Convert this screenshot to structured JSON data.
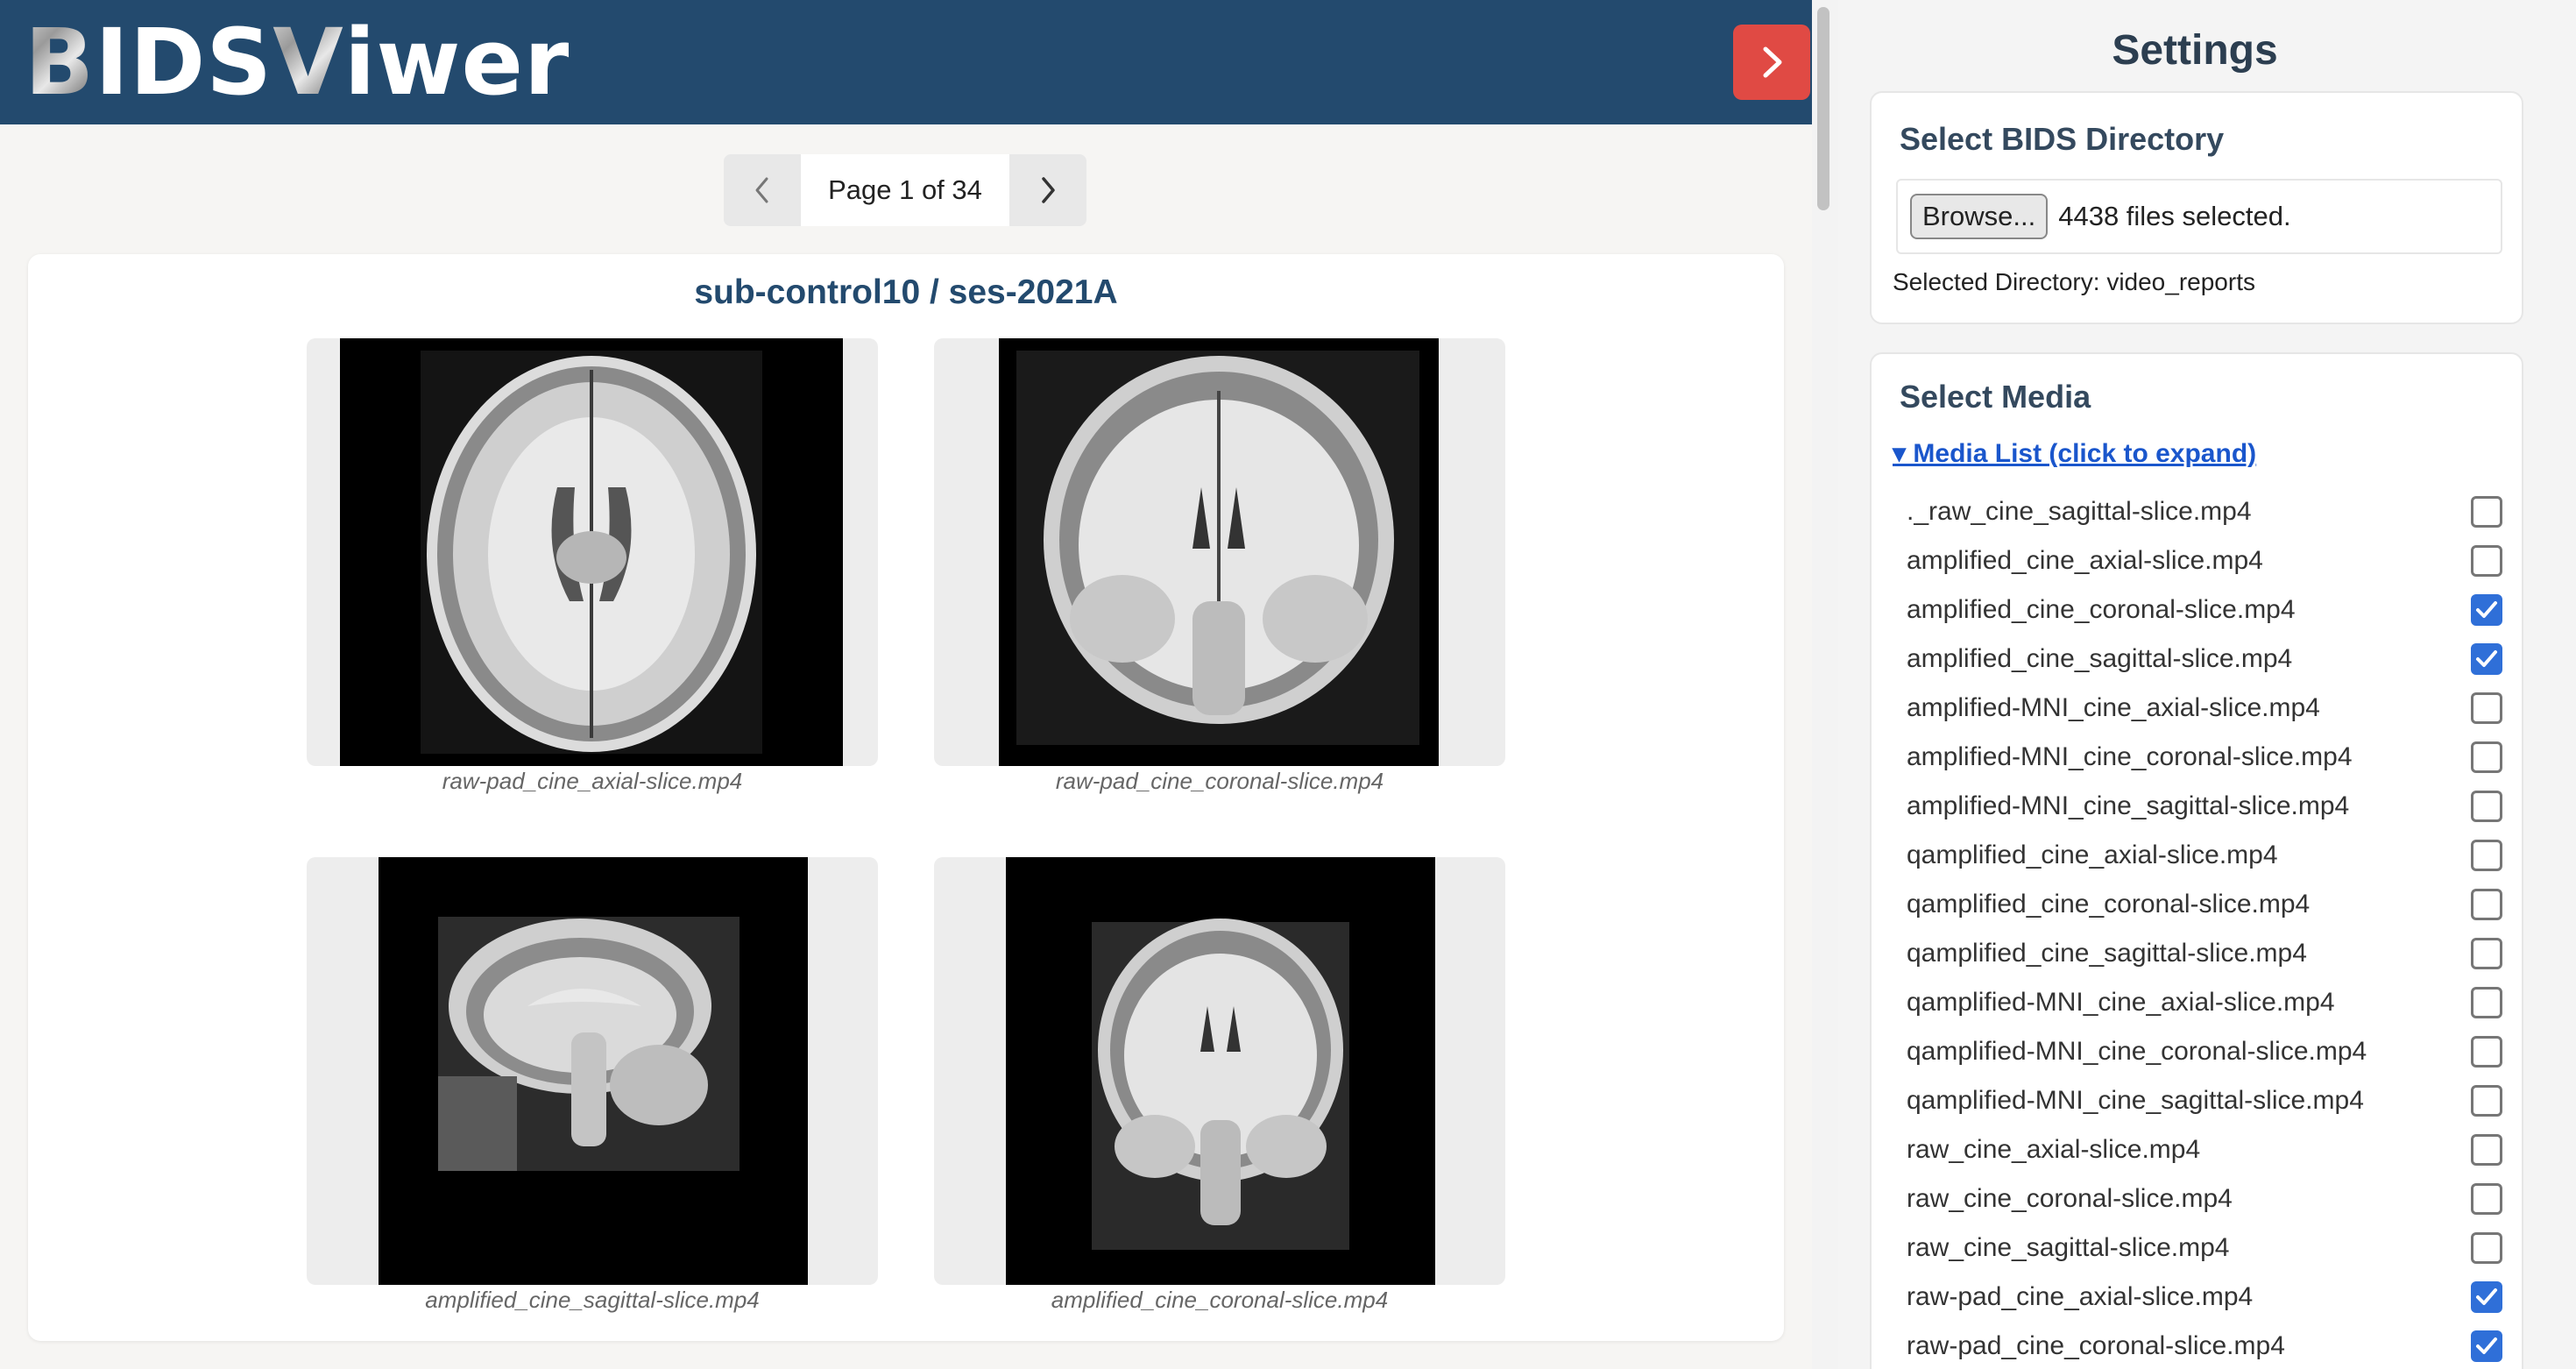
{
  "header": {
    "logo_b": "B",
    "logo_ids": "IDS",
    "logo_v": "V",
    "logo_iwer": "iwer",
    "toggle_icon": "chevron-right-icon"
  },
  "pager": {
    "text": "Page 1 of 34",
    "prev_icon": "chevron-left-icon",
    "next_icon": "chevron-right-icon"
  },
  "panel": {
    "title": "sub-control10 / ses-2021A",
    "videos": [
      {
        "caption": "raw-pad_cine_axial-slice.mp4"
      },
      {
        "caption": "raw-pad_cine_coronal-slice.mp4"
      },
      {
        "caption": "amplified_cine_sagittal-slice.mp4"
      },
      {
        "caption": "amplified_cine_coronal-slice.mp4"
      }
    ]
  },
  "sidebar": {
    "title": "Settings",
    "directory": {
      "heading": "Select BIDS Directory",
      "browse_label": "Browse...",
      "files_status": "4438 files selected.",
      "selected_directory": "Selected Directory: video_reports"
    },
    "media": {
      "heading": "Select Media",
      "summary": "▾ Media List (click to expand)",
      "items": [
        {
          "label": "._raw_cine_sagittal-slice.mp4",
          "checked": false
        },
        {
          "label": "amplified_cine_axial-slice.mp4",
          "checked": false
        },
        {
          "label": "amplified_cine_coronal-slice.mp4",
          "checked": true
        },
        {
          "label": "amplified_cine_sagittal-slice.mp4",
          "checked": true
        },
        {
          "label": "amplified-MNI_cine_axial-slice.mp4",
          "checked": false
        },
        {
          "label": "amplified-MNI_cine_coronal-slice.mp4",
          "checked": false
        },
        {
          "label": "amplified-MNI_cine_sagittal-slice.mp4",
          "checked": false
        },
        {
          "label": "qamplified_cine_axial-slice.mp4",
          "checked": false
        },
        {
          "label": "qamplified_cine_coronal-slice.mp4",
          "checked": false
        },
        {
          "label": "qamplified_cine_sagittal-slice.mp4",
          "checked": false
        },
        {
          "label": "qamplified-MNI_cine_axial-slice.mp4",
          "checked": false
        },
        {
          "label": "qamplified-MNI_cine_coronal-slice.mp4",
          "checked": false
        },
        {
          "label": "qamplified-MNI_cine_sagittal-slice.mp4",
          "checked": false
        },
        {
          "label": "raw_cine_axial-slice.mp4",
          "checked": false
        },
        {
          "label": "raw_cine_coronal-slice.mp4",
          "checked": false
        },
        {
          "label": "raw_cine_sagittal-slice.mp4",
          "checked": false
        },
        {
          "label": "raw-pad_cine_axial-slice.mp4",
          "checked": true
        },
        {
          "label": "raw-pad_cine_coronal-slice.mp4",
          "checked": true
        }
      ]
    }
  },
  "colors": {
    "header_bg": "#234a6e",
    "toggle_bg": "#e04a44",
    "title_color": "#234a6e",
    "checkbox_on": "#2f6fd8",
    "link_color": "#1a56cc"
  }
}
